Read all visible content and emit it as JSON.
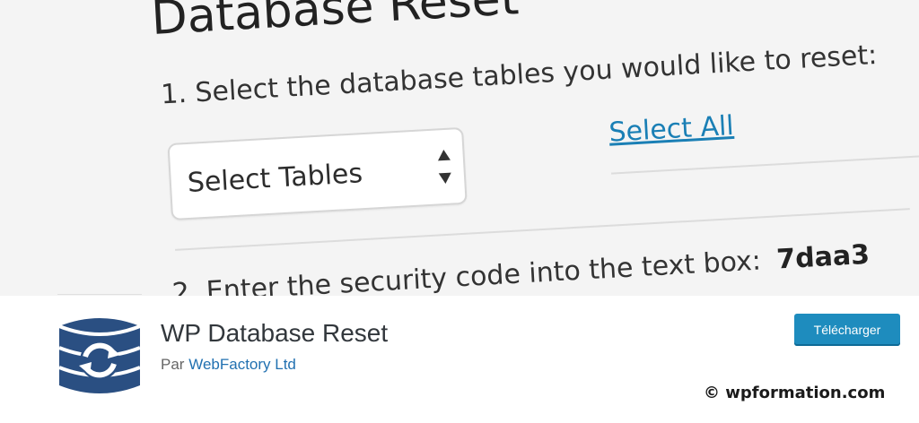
{
  "banner": {
    "heading": "Database Reset",
    "step1": "1. Select the database tables you would like to reset:",
    "select_label": "Select Tables",
    "select_all": "Select All",
    "step2": "2. Enter the security code into the text box:",
    "security_code": "7daa3"
  },
  "plugin": {
    "title": "WP Database Reset",
    "by": "Par",
    "author": "WebFactory Ltd",
    "download_label": "Télécharger",
    "icon": "database-refresh-icon",
    "icon_color": "#2a4f82"
  },
  "watermark": "© wpformation.com",
  "colors": {
    "link": "#1a7fb5",
    "button": "#1e8cbe"
  }
}
